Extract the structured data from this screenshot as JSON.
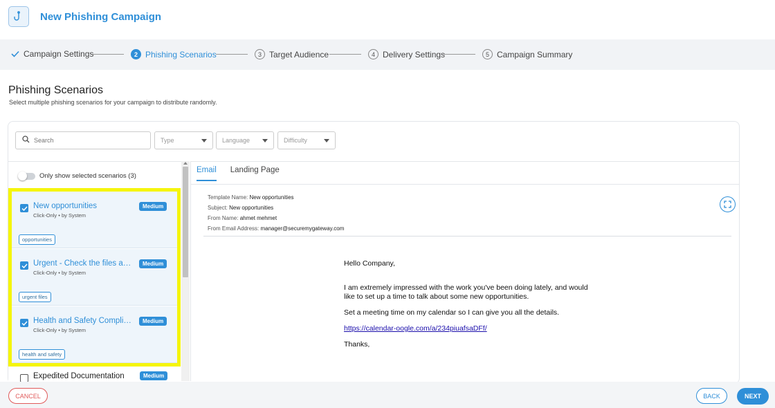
{
  "header": {
    "title": "New Phishing Campaign",
    "logo_icon": "hook-icon"
  },
  "stepper": {
    "steps": [
      {
        "label": "Campaign Settings",
        "state": "done"
      },
      {
        "number": "2",
        "label": "Phishing Scenarios",
        "state": "active"
      },
      {
        "number": "3",
        "label": "Target Audience",
        "state": "pending"
      },
      {
        "number": "4",
        "label": "Delivery Settings",
        "state": "pending"
      },
      {
        "number": "5",
        "label": "Campaign Summary",
        "state": "pending"
      }
    ]
  },
  "section": {
    "title": "Phishing Scenarios",
    "subtitle": "Select multiple phishing scenarios for your campaign to distribute randomly."
  },
  "filters": {
    "search_placeholder": "Search",
    "type_placeholder": "Type",
    "language_placeholder": "Language",
    "difficulty_placeholder": "Difficulty"
  },
  "toggle": {
    "label": "Only show selected scenarios (3)",
    "on": false
  },
  "scenarios": [
    {
      "title": "New opportunities",
      "meta": "Click-Only • by System",
      "badge": "Medium",
      "tag": "opportunities",
      "checked": true
    },
    {
      "title": "Urgent - Check the files and",
      "meta": "Click-Only • by System",
      "badge": "Medium",
      "tag": "urgent files",
      "checked": true
    },
    {
      "title": "Health and Safety Compliance",
      "meta": "Click-Only • by System",
      "badge": "Medium",
      "tag": "health and safety",
      "checked": true
    },
    {
      "title": "Expedited Documentation",
      "badge": "Medium",
      "checked": false
    }
  ],
  "preview": {
    "tabs": [
      "Email",
      "Landing Page"
    ],
    "active_tab": "Email",
    "template_name_label": "Template Name:",
    "template_name": "New opportunities",
    "subject_label": "Subject:",
    "subject": "New opportunities",
    "from_name_label": "From Name:",
    "from_name": "ahmet mehmet",
    "from_email_label": "From Email Address:",
    "from_email": "manager@securemygateway.com",
    "email": {
      "greeting": "Hello Company,",
      "para1": "I am extremely impressed with the work you've been doing lately, and would like to set up a time to talk about some new opportunities.",
      "para2": "Set a meeting time on my calendar so I can give you all the details.",
      "link": "https://calendar-oogle.com/a/234piuafsaDFf/",
      "closing": "Thanks,"
    }
  },
  "footer": {
    "cancel": "CANCEL",
    "back": "BACK",
    "next": "NEXT"
  },
  "colors": {
    "accent": "#2f8fd8",
    "danger": "#e05a5a",
    "highlight": "#f5f50a"
  }
}
